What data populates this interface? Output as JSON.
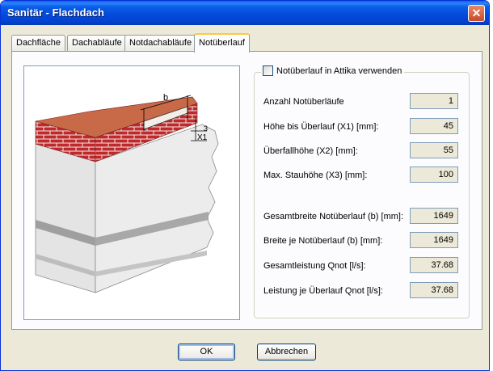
{
  "window": {
    "title": "Sanitär - Flachdach",
    "close_symbol": "✕"
  },
  "tabs": [
    {
      "label": "Dachfläche",
      "active": false
    },
    {
      "label": "Dachabläufe",
      "active": false
    },
    {
      "label": "Notdachabläufe",
      "active": false
    },
    {
      "label": "Notüberlauf",
      "active": true
    }
  ],
  "diagram": {
    "label_b": "b",
    "label_x1": "X1",
    "label_x3": "3",
    "colors": {
      "brick": "#c0282c",
      "mortar": "#f0ece4",
      "wall": "#e6e6e6",
      "stripe": "#9f9f9f"
    }
  },
  "group": {
    "checkbox_label": "Notüberlauf in Attika verwenden",
    "checkbox_checked": false,
    "inputs": [
      {
        "label": "Anzahl Notüberläufe",
        "value": "1"
      },
      {
        "label": "Höhe bis Überlauf (X1) [mm]:",
        "value": "45"
      },
      {
        "label": "Überfallhöhe (X2) [mm]:",
        "value": "55"
      },
      {
        "label": "Max. Stauhöhe (X3) [mm]:",
        "value": "100"
      }
    ],
    "results": [
      {
        "label": "Gesamtbreite Notüberlauf (b) [mm]:",
        "value": "1649"
      },
      {
        "label": "Breite je Notüberlauf (b) [mm]:",
        "value": "1649"
      },
      {
        "label": "Gesamtleistung Qnot [l/s]:",
        "value": "37.68"
      },
      {
        "label": "Leistung je Überlauf Qnot [l/s]:",
        "value": "37.68"
      }
    ]
  },
  "buttons": {
    "ok": "OK",
    "cancel": "Abbrechen"
  }
}
